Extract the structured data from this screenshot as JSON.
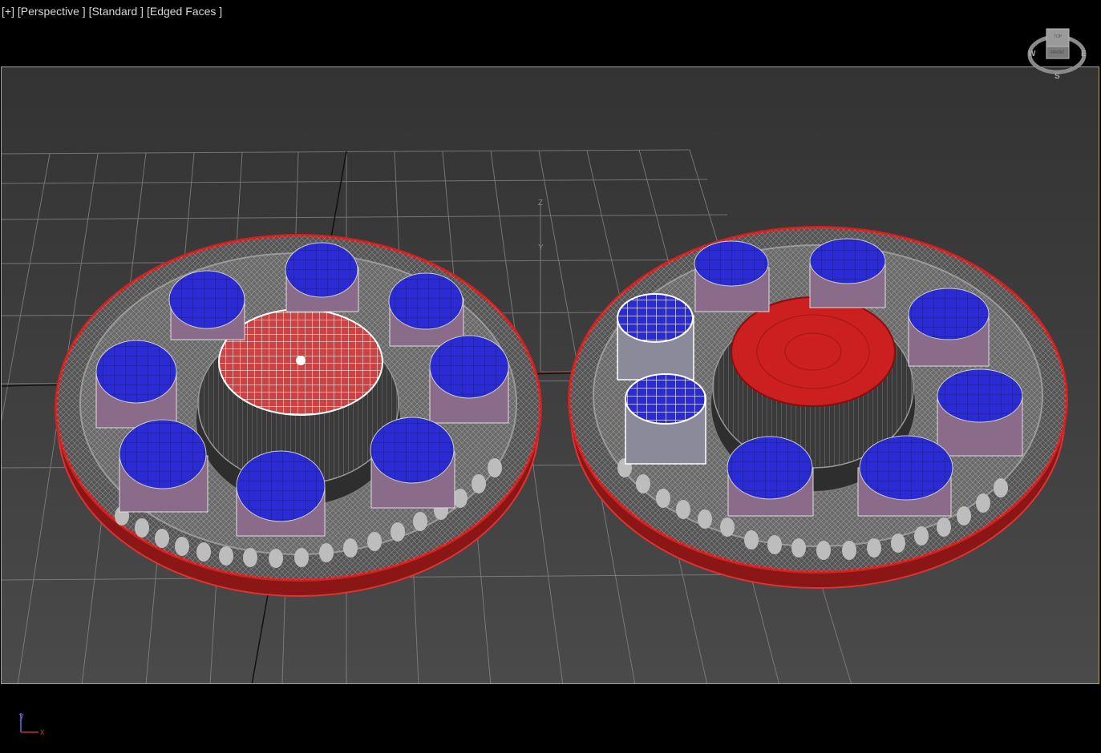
{
  "viewport_labels": {
    "plus": "[+]",
    "view": "[Perspective ]",
    "shading_style": "[Standard ]",
    "shading_mode": "[Edged Faces ]"
  },
  "viewcube": {
    "top_face": "TOP",
    "front_face": "FRONT",
    "west": "W",
    "east": "E",
    "south": "S"
  },
  "world_axis": {
    "z": "Z",
    "y": "Y"
  },
  "axis_tripod": {
    "y": "y",
    "x": "x"
  },
  "colors": {
    "viewport_border": "#b8a64a",
    "object_red": "#b01818",
    "cap_blue": "#2a2ad8",
    "wire_gray": "#9a9a9a"
  }
}
